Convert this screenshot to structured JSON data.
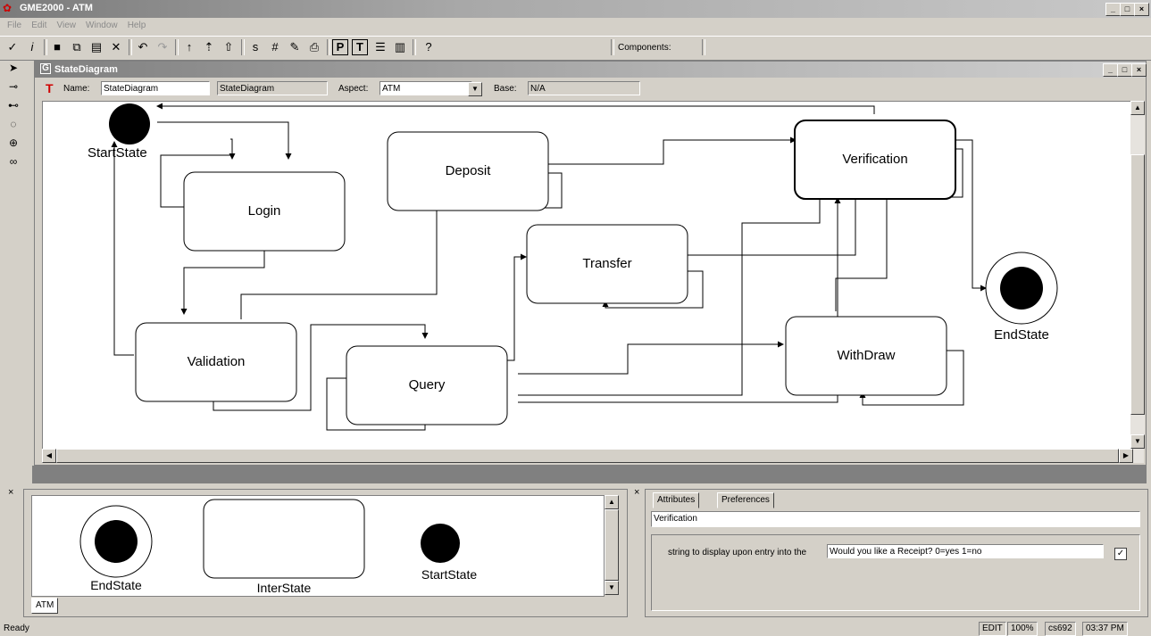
{
  "window": {
    "title": "GME2000 - ATM",
    "controls": [
      "_",
      "□",
      "×"
    ]
  },
  "menu": [
    "File",
    "Edit",
    "View",
    "Window",
    "Help"
  ],
  "toolbar": {
    "components_label": "Components:"
  },
  "subwindow": {
    "title": "StateDiagram",
    "name_label": "Name:",
    "name_value": "StateDiagram",
    "kind_value": "StateDiagram",
    "aspect_label": "Aspect:",
    "aspect_value": "ATM",
    "base_label": "Base:",
    "base_value": "N/A"
  },
  "diagram": {
    "states": {
      "start": "StartState",
      "login": "Login",
      "deposit": "Deposit",
      "verification": "Verification",
      "transfer": "Transfer",
      "validation": "Validation",
      "query": "Query",
      "withdraw": "WithDraw",
      "end": "EndState"
    }
  },
  "parts_browser": {
    "items": [
      "EndState",
      "InterState",
      "StartState"
    ],
    "tab": "ATM"
  },
  "attributes_panel": {
    "tabs": [
      "Attributes",
      "Preferences"
    ],
    "object_name": "Verification",
    "attr_label": "string to display upon entry into the state",
    "attr_value": "Would you like a Receipt? 0=yes  1=no",
    "checkbox_checked": true
  },
  "statusbar": {
    "left": "Ready",
    "mode": "EDIT",
    "zoom": "100%",
    "user": "cs692",
    "time": "03:37 PM"
  }
}
